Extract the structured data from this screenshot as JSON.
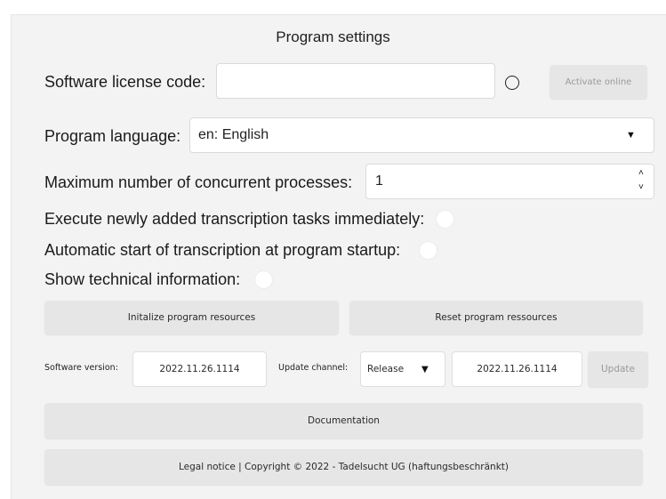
{
  "header": {
    "title": "Program settings"
  },
  "license": {
    "label": "Software license code:",
    "value": "",
    "activate_label": "Activate online"
  },
  "language": {
    "label": "Program language:",
    "selected": "en: English"
  },
  "processes": {
    "label": "Maximum number of concurrent processes:",
    "value": "1"
  },
  "options": [
    {
      "label": "Execute newly added transcription tasks immediately:",
      "checked": false
    },
    {
      "label": "Automatic start of transcription at program startup:",
      "checked": false
    },
    {
      "label": "Show technical information:",
      "checked": false
    }
  ],
  "resources": {
    "init_label": "Initalize program resources",
    "reset_label": "Reset program ressources"
  },
  "version": {
    "version_label": "Software version:",
    "version_value": "2022.11.26.1114",
    "channel_label": "Update channel:",
    "channel_selected": "Release",
    "latest_value": "2022.11.26.1114",
    "update_label": "Update"
  },
  "footer": {
    "documentation_label": "Documentation",
    "legal_label": "Legal notice | Copyright © 2022 - Tadelsucht UG (haftungsbeschränkt)"
  },
  "icons": {
    "dropdown": "caret-down",
    "spinner": "chevron-up-down",
    "status": "circle-outline"
  },
  "colors": {
    "panel_bg": "#f3f3f3",
    "button_bg": "#e6e6e6",
    "field_bg": "#ffffff"
  }
}
